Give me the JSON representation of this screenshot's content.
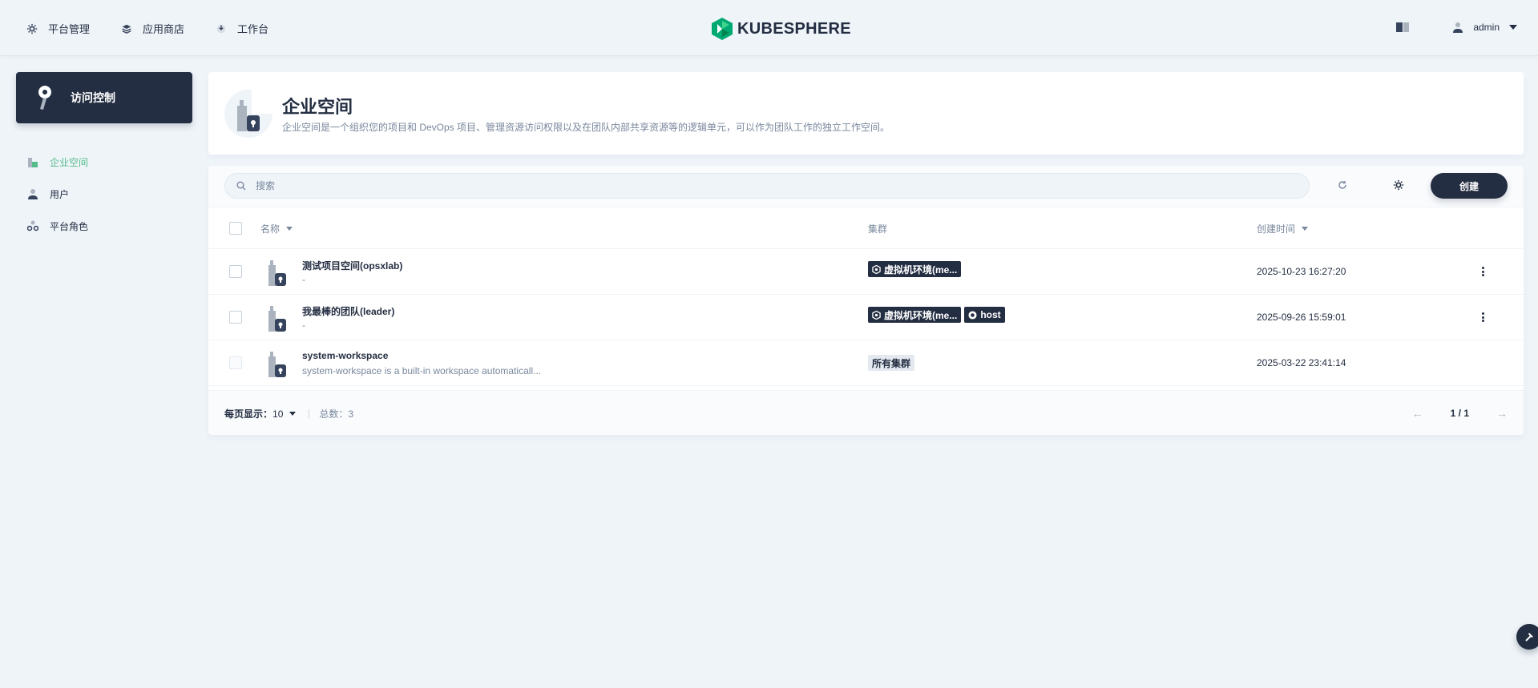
{
  "topnav": {
    "items": [
      {
        "label": "平台管理",
        "icon": "gear-icon"
      },
      {
        "label": "应用商店",
        "icon": "layers-icon"
      },
      {
        "label": "工作台",
        "icon": "download-icon"
      }
    ],
    "logo_text": "KUBESPHERE",
    "user": "admin"
  },
  "sidebar": {
    "title": "访问控制",
    "items": [
      {
        "label": "企业空间",
        "active": true
      },
      {
        "label": "用户",
        "active": false
      },
      {
        "label": "平台角色",
        "active": false
      }
    ]
  },
  "banner": {
    "title": "企业空间",
    "description": "企业空间是一个组织您的项目和 DevOps 项目、管理资源访问权限以及在团队内部共享资源等的逻辑单元，可以作为团队工作的独立工作空间。"
  },
  "toolbar": {
    "search_placeholder": "搜索",
    "create_label": "创建"
  },
  "table": {
    "columns": {
      "name": "名称",
      "cluster": "集群",
      "created": "创建时间"
    },
    "rows": [
      {
        "name": "测试项目空间(opsxlab)",
        "desc": "-",
        "clusters": [
          "虚拟机环境(me..."
        ],
        "created": "2025-10-23 16:27:20"
      },
      {
        "name": "我最棒的团队(leader)",
        "desc": "-",
        "clusters": [
          "虚拟机环境(me...",
          "host"
        ],
        "created": "2025-09-26 15:59:01"
      },
      {
        "name": "system-workspace",
        "desc": "system-workspace is a built-in workspace automaticall...",
        "clusters": [
          "所有集群"
        ],
        "created": "2025-03-22 23:41:14"
      }
    ]
  },
  "footer": {
    "per_page_label": "每页显示：",
    "per_page_value": "10",
    "total_label": "总数：3",
    "page": "1 / 1",
    "prev": "←",
    "next": "→"
  },
  "colors": {
    "accent": "#55bc8a",
    "dark": "#242e42",
    "bg": "#eff4f9"
  }
}
